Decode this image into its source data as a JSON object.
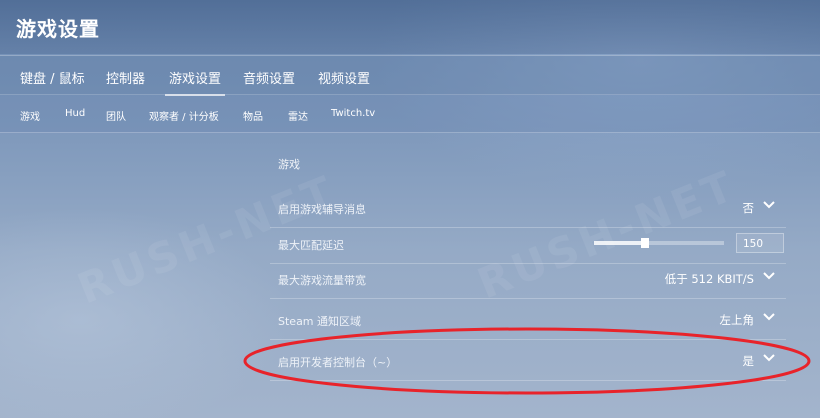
{
  "header": {
    "title": "游戏设置"
  },
  "tabs": [
    {
      "label": "键盘 / 鼠标",
      "active": false
    },
    {
      "label": "控制器",
      "active": false
    },
    {
      "label": "游戏设置",
      "active": true
    },
    {
      "label": "音频设置",
      "active": false
    },
    {
      "label": "视频设置",
      "active": false
    }
  ],
  "subtabs": [
    {
      "label": "游戏"
    },
    {
      "label": "Hud"
    },
    {
      "label": "团队"
    },
    {
      "label": "观察者 / 计分板"
    },
    {
      "label": "物品"
    },
    {
      "label": "雷达"
    },
    {
      "label": "Twitch.tv"
    }
  ],
  "watermark": "RUSH-NET",
  "section": {
    "title": "游戏",
    "rows": [
      {
        "label": "启用游戏辅导消息",
        "value": "否",
        "control": "dropdown"
      },
      {
        "label": "最大匹配延迟",
        "value": "150",
        "control": "slider",
        "fraction": 0.39
      },
      {
        "label": "最大游戏流量带宽",
        "value": "低于 512 KBIT/S",
        "control": "dropdown"
      },
      {
        "label": "Steam 通知区域",
        "value": "左上角",
        "control": "dropdown"
      },
      {
        "label": "启用开发者控制台（~）",
        "value": "是",
        "control": "dropdown"
      }
    ]
  },
  "colors": {
    "annotation": "#e8232a",
    "accent": "#ffffff"
  },
  "icons": {
    "dropdown": "chevron-down-icon"
  }
}
